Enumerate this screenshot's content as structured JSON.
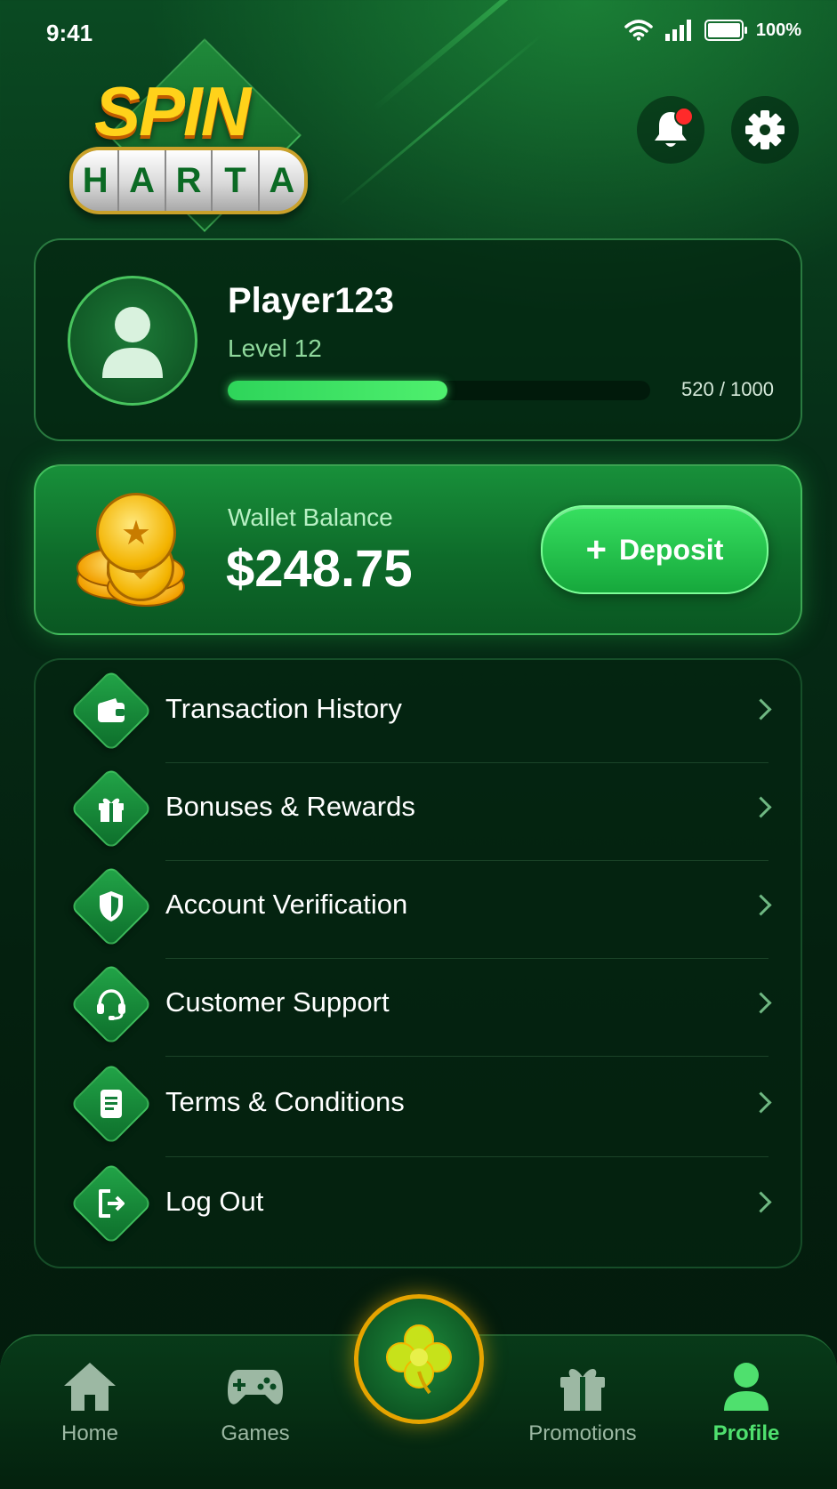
{
  "status_bar": {
    "time": "9:41",
    "battery": "100%"
  },
  "logo": {
    "top": "SPIN",
    "reel_letters": [
      "H",
      "A",
      "R",
      "T",
      "A"
    ]
  },
  "header": {
    "notification_icon": "bell-icon",
    "settings_icon": "gear-icon",
    "has_notification": true
  },
  "profile": {
    "username": "Player123",
    "level": "Level 12",
    "xp_text": "520 / 1000",
    "xp_progress": 0.52
  },
  "wallet": {
    "label": "Wallet Balance",
    "amount": "$248.75",
    "deposit_label": "Deposit"
  },
  "menu": {
    "items": [
      {
        "label": "Transaction History",
        "icon": "wallet-icon"
      },
      {
        "label": "Bonuses & Rewards",
        "icon": "gift-icon"
      },
      {
        "label": "Account Verification",
        "icon": "shield-icon"
      },
      {
        "label": "Customer Support",
        "icon": "headset-icon"
      },
      {
        "label": "Terms & Conditions",
        "icon": "document-icon"
      },
      {
        "label": "Log Out",
        "icon": "logout-icon"
      }
    ]
  },
  "nav": {
    "items": [
      {
        "label": "Home",
        "icon": "home-icon"
      },
      {
        "label": "Games",
        "icon": "gamepad-icon"
      },
      {
        "label": "Promotions",
        "icon": "gift-icon"
      },
      {
        "label": "Profile",
        "icon": "user-icon",
        "active": true
      }
    ],
    "center_icon": "clover-icon"
  },
  "colors": {
    "accent": "#2ed45a",
    "active_nav": "#4fe06e",
    "notification": "#ff2a2a",
    "gold": "#ffd21a"
  }
}
